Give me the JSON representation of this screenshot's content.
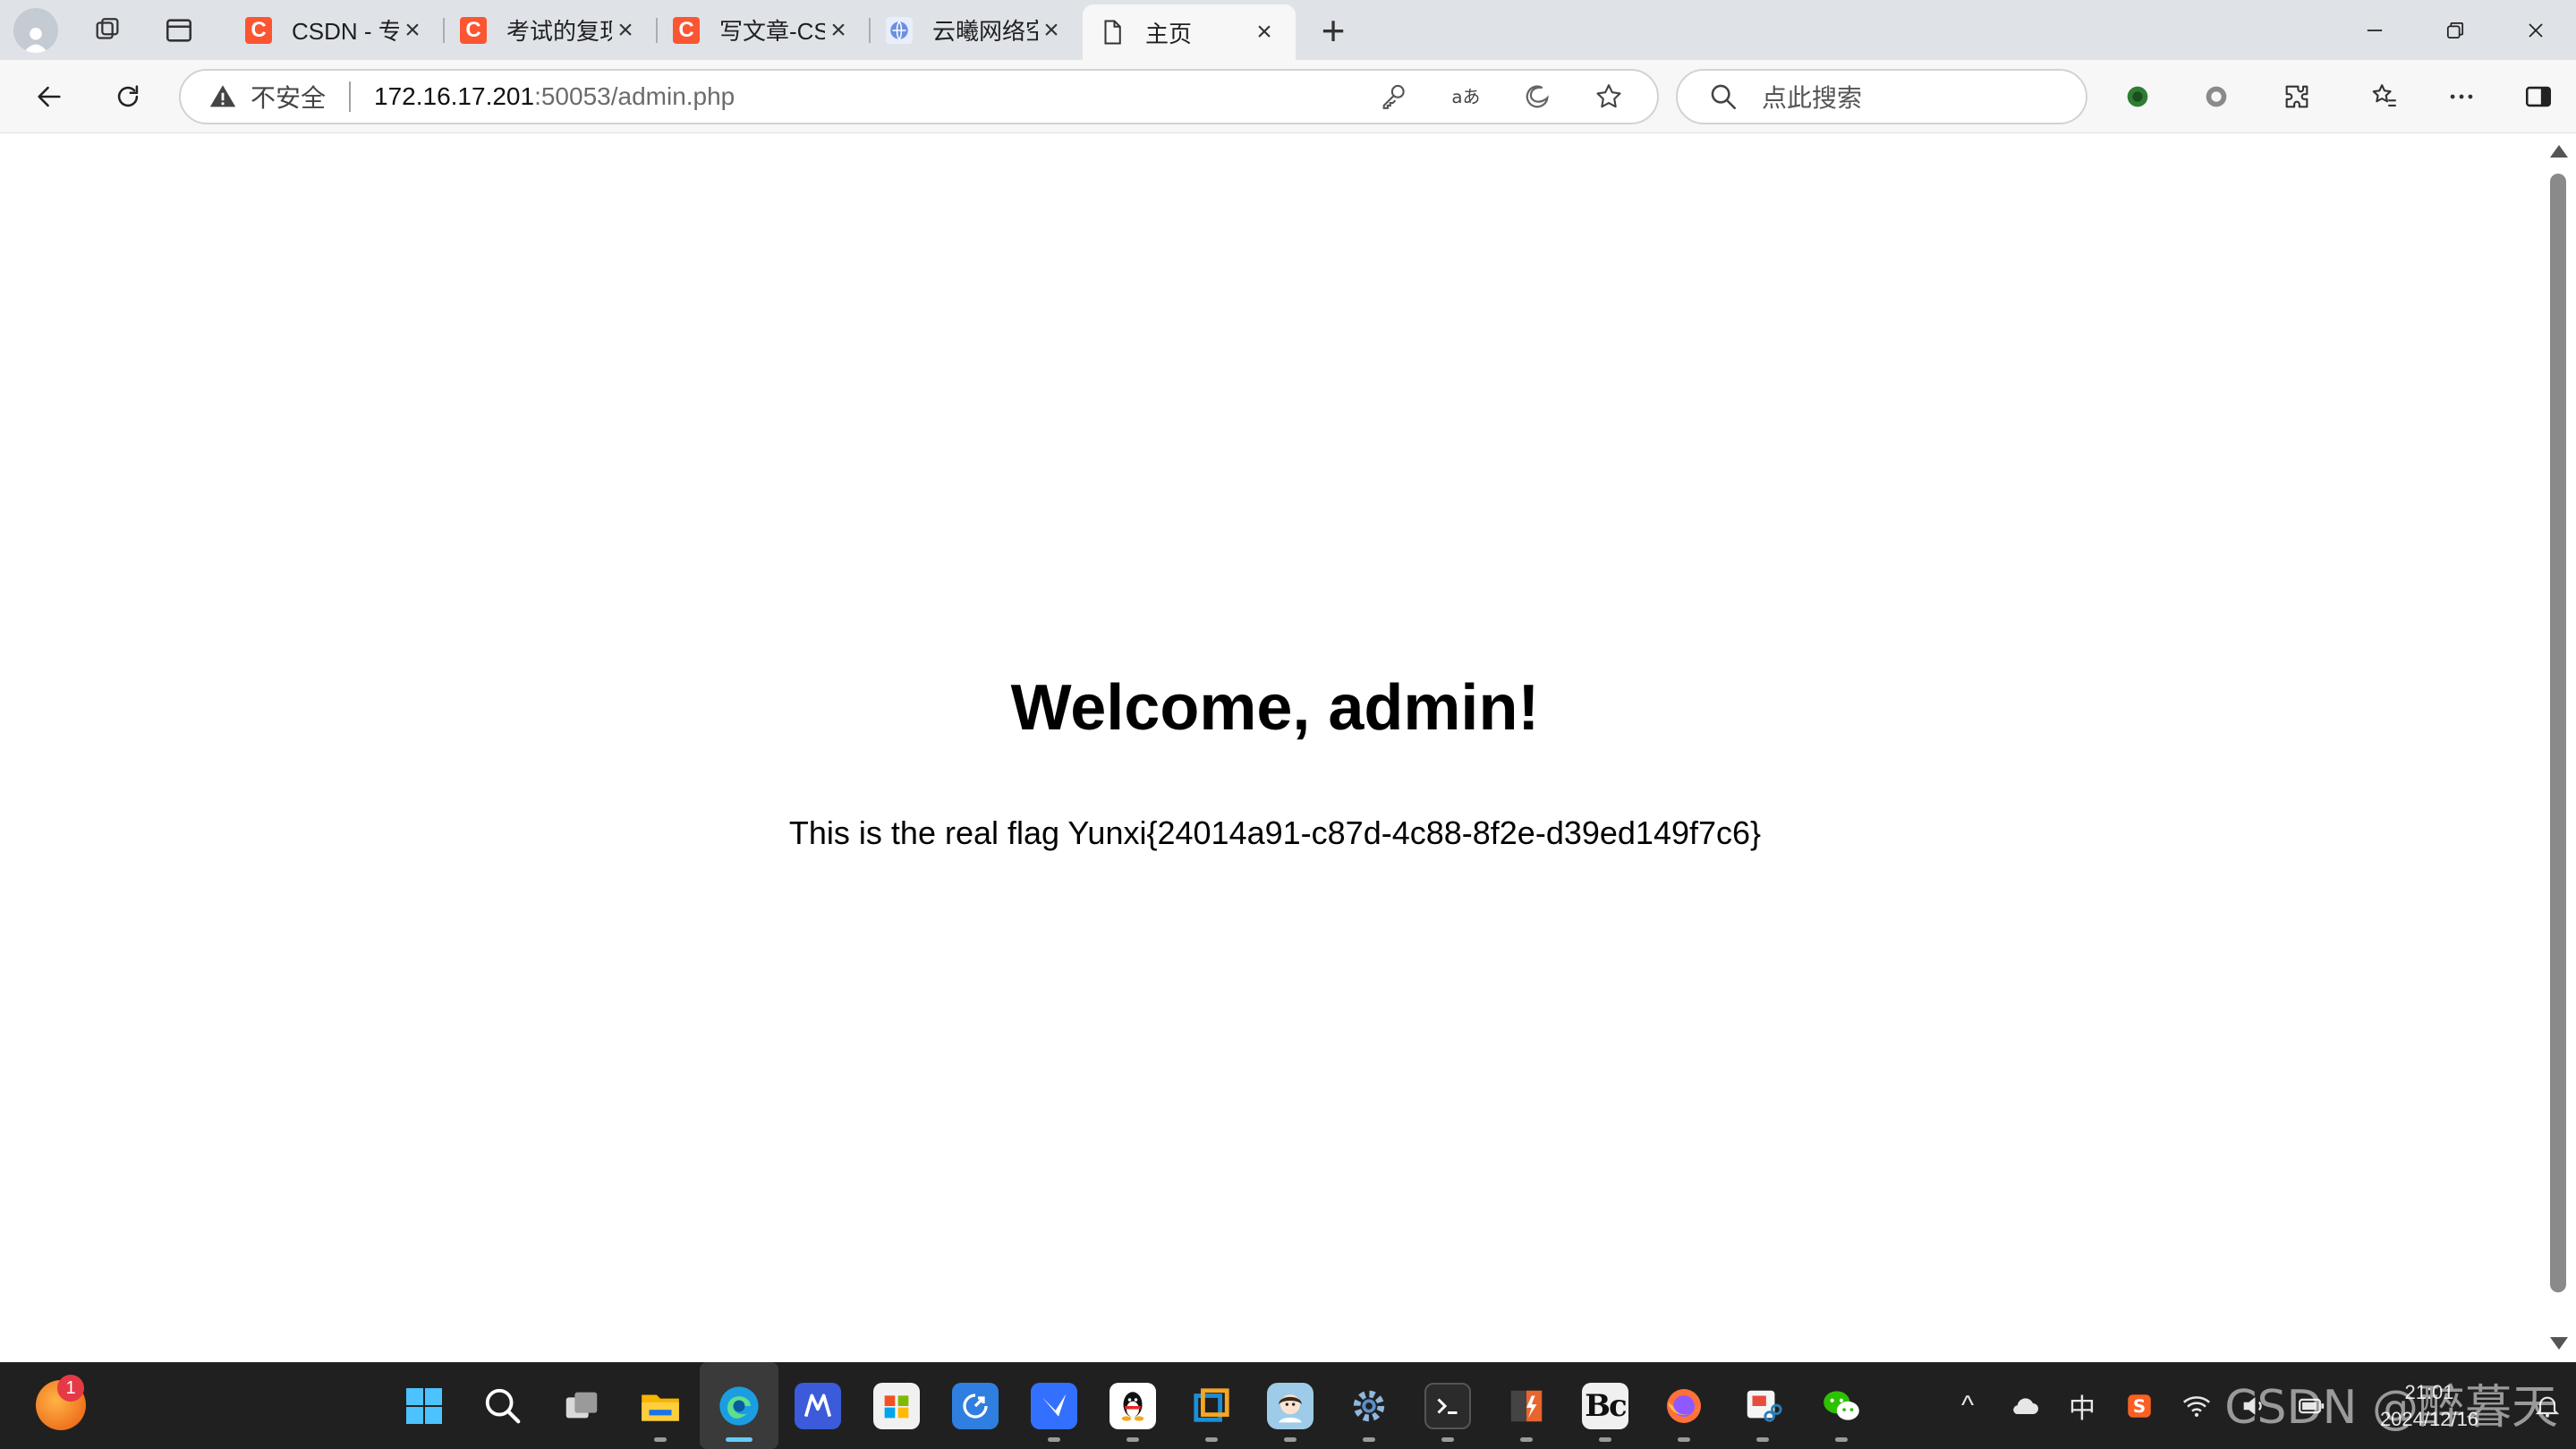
{
  "browser": {
    "tabs": [
      {
        "title": "CSDN - 专业开发者社区",
        "favicon": "C",
        "favicon_color": "#fc5531",
        "active": false
      },
      {
        "title": "考试的复现-CSDN博客",
        "favicon": "C",
        "favicon_color": "#fc5531",
        "active": false
      },
      {
        "title": "写文章-CSDN博客",
        "favicon": "C",
        "favicon_color": "#fc5531",
        "active": false
      },
      {
        "title": "云曦网络空间安全研究室CTF$",
        "favicon": "globe",
        "favicon_color": "#3b6fd8",
        "active": false
      },
      {
        "title": "主页",
        "favicon": "page",
        "favicon_color": "#ffffff",
        "active": true
      }
    ],
    "new_tab_label": "+",
    "address": {
      "security_label": "不安全",
      "host": "172.16.17.201",
      "path": ":50053/admin.php"
    },
    "search_placeholder": "点此搜索"
  },
  "page": {
    "heading": "Welcome, admin!",
    "flag_text": "This is the real flag Yunxi{24014a91-c87d-4c88-8f2e-d39ed149f7c6}"
  },
  "taskbar": {
    "widget_badge": "1",
    "apps": [
      {
        "name": "start",
        "color": "#2b88d8",
        "glyph": "⊞"
      },
      {
        "name": "search",
        "color": "transparent",
        "glyph": "🔍"
      },
      {
        "name": "task-view",
        "color": "transparent",
        "glyph": "❐"
      },
      {
        "name": "file-explorer",
        "color": "#f2b01e",
        "glyph": "▬"
      },
      {
        "name": "edge",
        "color": "#1a9ad6",
        "glyph": "e"
      },
      {
        "name": "app-m",
        "color": "#3b5bdb",
        "glyph": "M"
      },
      {
        "name": "ms-store",
        "color": "#f1f1f1",
        "glyph": "▦"
      },
      {
        "name": "app-blue",
        "color": "#2f7fe0",
        "glyph": "↗"
      },
      {
        "name": "app-feishu",
        "color": "#3370ff",
        "glyph": "✈"
      },
      {
        "name": "qq",
        "color": "#ffffff",
        "glyph": "🐧"
      },
      {
        "name": "app-vmware",
        "color": "#1b8fd8",
        "glyph": "▣"
      },
      {
        "name": "app-avatar",
        "color": "#9ecbe8",
        "glyph": "☺"
      },
      {
        "name": "settings",
        "color": "transparent",
        "glyph": "⚙"
      },
      {
        "name": "terminal",
        "color": "#2b2b2b",
        "glyph": "›_"
      },
      {
        "name": "app-burp",
        "color": "#e8652d",
        "glyph": "⚡"
      },
      {
        "name": "app-bc",
        "color": "#111111",
        "glyph": "Bc"
      },
      {
        "name": "firefox",
        "color": "#ff7139",
        "glyph": "●"
      },
      {
        "name": "app-snip",
        "color": "#f5f5f5",
        "glyph": "✂"
      },
      {
        "name": "wechat",
        "color": "#2dc100",
        "glyph": "💬"
      }
    ],
    "tray": {
      "chevron": "^",
      "ime": "中",
      "time": "21:01",
      "date": "2024/12/16"
    }
  },
  "watermark": "CSDN @醉暮天"
}
